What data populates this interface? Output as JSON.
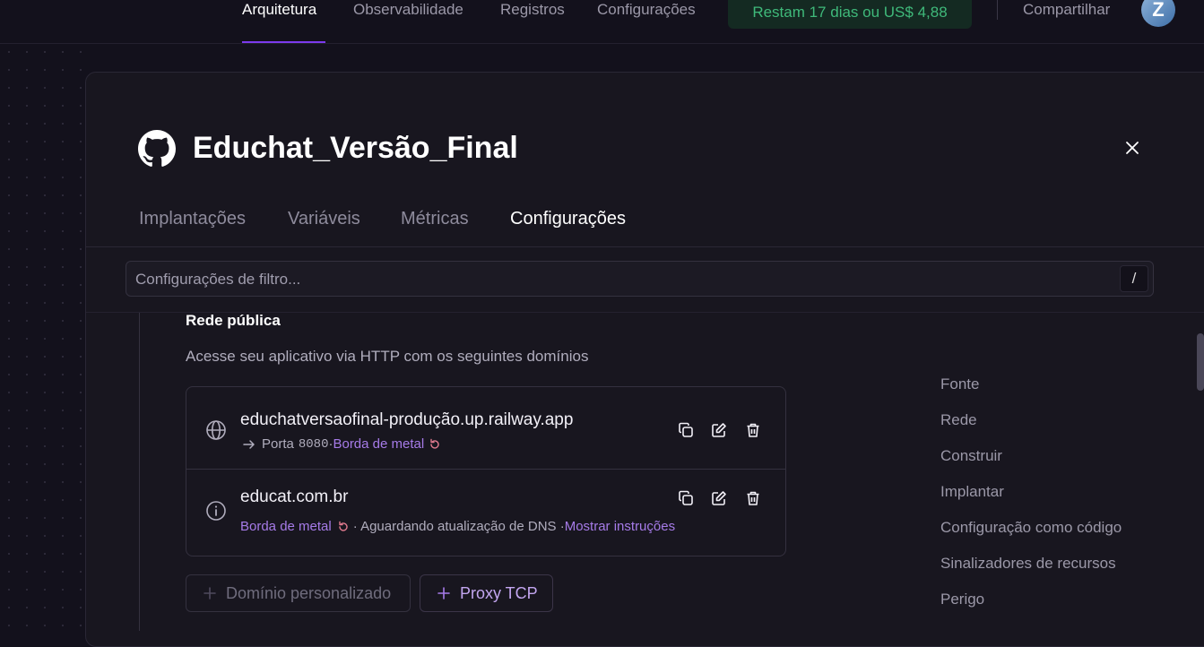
{
  "nav": {
    "items": [
      "Arquitetura",
      "Observabilidade",
      "Registros",
      "Configurações"
    ],
    "active": "Arquitetura",
    "trial_badge": "Restam 17 dias ou US$ 4,88",
    "share": "Compartilhar",
    "avatar_letter": "Z"
  },
  "service": {
    "title": "Educhat_Versão_Final",
    "tabs": [
      "Implantações",
      "Variáveis",
      "Métricas",
      "Configurações"
    ],
    "active_tab": "Configurações"
  },
  "filter": {
    "placeholder": "Configurações de filtro...",
    "shortcut": "/"
  },
  "public_network": {
    "title": "Rede pública",
    "description": "Acesse seu aplicativo via HTTP com os seguintes domínios",
    "domains": [
      {
        "name": "educhatversaofinal-produção.up.railway.app",
        "port_label": "Porta",
        "port": "8080",
        "sep": "·",
        "edge": "Borda de metal"
      },
      {
        "name": "educat.com.br",
        "edge": "Borda de metal",
        "status": "· Aguardando atualização de DNS ·",
        "instructions": "Mostrar instruções"
      }
    ],
    "buttons": {
      "custom_domain": "Domínio personalizado",
      "tcp_proxy": "Proxy TCP"
    }
  },
  "side_nav": [
    "Fonte",
    "Rede",
    "Construir",
    "Implantar",
    "Configuração como código",
    "Sinalizadores de recursos",
    "Perigo"
  ],
  "colors": {
    "accent": "#7c3aed",
    "edge_link": "#a67be8",
    "trial_green": "#3fb97a"
  }
}
